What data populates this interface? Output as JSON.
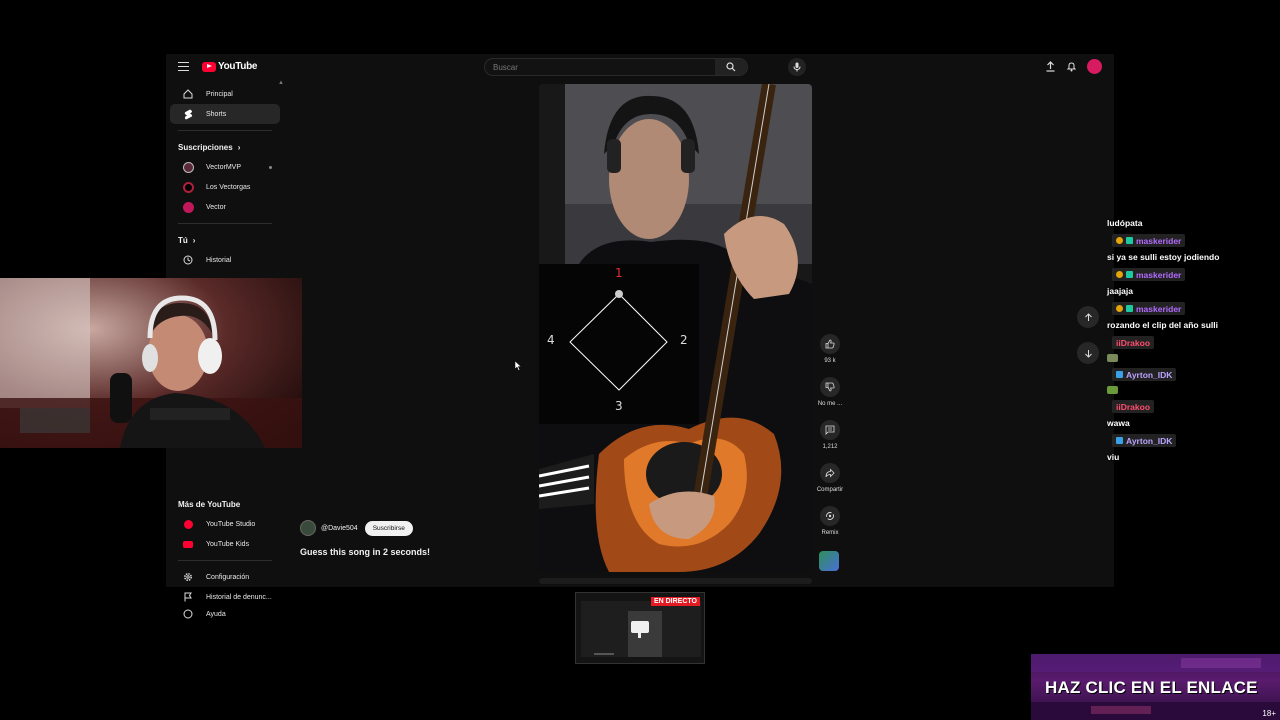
{
  "youtube": {
    "logo_text": "YouTube",
    "search": {
      "placeholder": "Buscar"
    }
  },
  "sidebar": {
    "main_items": [
      {
        "label": "Principal"
      },
      {
        "label": "Shorts"
      }
    ],
    "subscriptions_header": "Suscripciones",
    "subscriptions": [
      {
        "label": "VectorMVP"
      },
      {
        "label": "Los Vectorgas"
      },
      {
        "label": "Vector"
      }
    ],
    "you_header": "Tú",
    "you_items": [
      {
        "label": "Historial"
      }
    ],
    "more_header": "Más de YouTube",
    "more_items": [
      {
        "label": "YouTube Studio"
      },
      {
        "label": "YouTube Kids"
      }
    ],
    "settings_items": [
      {
        "label": "Configuración"
      },
      {
        "label": "Historial de denunc..."
      },
      {
        "label": "Ayuda"
      }
    ]
  },
  "short": {
    "channel": "@Davie504",
    "subscribe_label": "Suscribirse",
    "title": "Guess this song in 2 seconds!",
    "overlay_numbers": [
      "1",
      "2",
      "3",
      "4"
    ],
    "actions": {
      "likes": "93 k",
      "dislike": "No me ...",
      "comments": "1,212",
      "share": "Compartir",
      "remix": "Remix"
    }
  },
  "chat": {
    "messages": [
      {
        "user": "",
        "text": "ludópata"
      },
      {
        "user": "maskerider",
        "user_color": "#b36bff",
        "text": "si ya se sulli estoy jodiendo"
      },
      {
        "user": "maskerider",
        "user_color": "#b36bff",
        "text": "jaajaja"
      },
      {
        "user": "maskerider",
        "user_color": "#b36bff",
        "text": "rozando el clip del año sulli"
      },
      {
        "user": "iiDrakoo",
        "user_color": "#ff4d6d",
        "text": ""
      },
      {
        "user": "Ayrton_IDK",
        "user_color": "#b9a3ff",
        "text": ""
      },
      {
        "user": "iiDrakoo",
        "user_color": "#ff4d6d",
        "text": "wawa"
      },
      {
        "user": "Ayrton_IDK",
        "user_color": "#b9a3ff",
        "text": "viu"
      }
    ]
  },
  "live_preview": {
    "badge": "EN DIRECTO"
  },
  "ad": {
    "text": "HAZ CLIC EN EL ENLACE",
    "age": "18+"
  }
}
